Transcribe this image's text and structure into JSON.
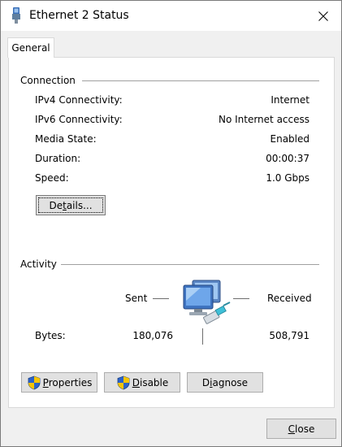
{
  "window": {
    "title": "Ethernet 2 Status",
    "title_icon": "network-adapter-icon",
    "close_icon": "close-icon"
  },
  "tabs": [
    {
      "label": "General",
      "selected": true
    }
  ],
  "connection": {
    "group_label": "Connection",
    "rows": [
      {
        "label": "IPv4 Connectivity:",
        "value": "Internet"
      },
      {
        "label": "IPv6 Connectivity:",
        "value": "No Internet access"
      },
      {
        "label": "Media State:",
        "value": "Enabled"
      },
      {
        "label": "Duration:",
        "value": "00:00:37"
      },
      {
        "label": "Speed:",
        "value": "1.0 Gbps"
      }
    ],
    "details_button": {
      "pre": "De",
      "accel": "t",
      "post": "ails..."
    }
  },
  "activity": {
    "group_label": "Activity",
    "sent_label": "Sent",
    "received_label": "Received",
    "bytes_label": "Bytes:",
    "bytes_sent": "180,076",
    "bytes_received": "508,791",
    "icon": "network-computer-icon"
  },
  "buttons": {
    "properties": {
      "accel": "P",
      "rest": "roperties",
      "icon": "uac-shield-icon"
    },
    "disable": {
      "accel": "D",
      "rest": "isable",
      "icon": "uac-shield-icon"
    },
    "diagnose": {
      "pre": "D",
      "accel": "i",
      "post": "agnose"
    },
    "close": {
      "accel": "C",
      "rest": "lose"
    }
  },
  "colors": {
    "shield_blue": "#2b63c8",
    "shield_yellow": "#f5c400",
    "button_face": "#e1e1e1",
    "panel_bg": "#ffffff",
    "window_bg": "#f0f0f0"
  }
}
